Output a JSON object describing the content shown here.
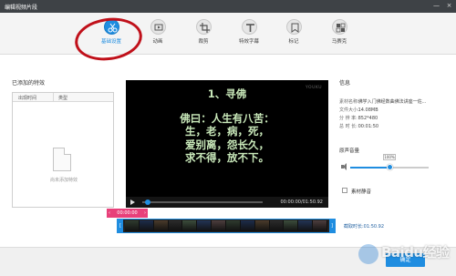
{
  "window": {
    "title": "编辑视频片段",
    "minimize_glyph": "—",
    "close_glyph": "×"
  },
  "toolbar": {
    "items": [
      {
        "label": "基础设置",
        "icon": "scissors-icon"
      },
      {
        "label": "动画",
        "icon": "animation-icon"
      },
      {
        "label": "裁剪",
        "icon": "crop-icon"
      },
      {
        "label": "特效字幕",
        "icon": "text-icon"
      },
      {
        "label": "标记",
        "icon": "bookmark-icon"
      },
      {
        "label": "马赛克",
        "icon": "mosaic-icon"
      }
    ],
    "active_index": 0,
    "accent": "#1f8de0",
    "annotation_color": "#c0101a"
  },
  "effects": {
    "title": "已添加的特效",
    "columns": [
      "出现时间",
      "类型"
    ],
    "empty_text": "尚未添加特效"
  },
  "preview": {
    "watermark": "YOUKU",
    "lines": [
      "1、寻佛",
      "佛曰：人生有八苦：",
      "生，老，病，死，",
      "爱别离，怨长久，",
      "求不得，放不下。"
    ],
    "text_color": "#c9e9ba",
    "time": "00:00:00/01:50.92",
    "progress": 0.02
  },
  "info": {
    "title": "信息",
    "rows": [
      {
        "key": "素材名称:",
        "value": "佛学入门佛经数曲佛法讲座一佐..."
      },
      {
        "key": "文件大小:",
        "value": "14.08MB"
      },
      {
        "key": "分 辨 率:",
        "value": "852*480"
      },
      {
        "key": "总 时 长:",
        "value": "00:01:50"
      }
    ]
  },
  "volume": {
    "label": "原声音量",
    "value_text": "100%",
    "level": 0.5
  },
  "mute": {
    "label": "素材静音"
  },
  "timeline": {
    "marker_time": "00:00:00",
    "marker_left": "‹",
    "marker_right": "›",
    "handle_left": "[",
    "handle_right": "]",
    "duration_label": "截取时长:01:50.92",
    "frame_count": 14
  },
  "buttons": {
    "ok": "确定"
  },
  "watermark": {
    "text": "Baidu经验"
  }
}
